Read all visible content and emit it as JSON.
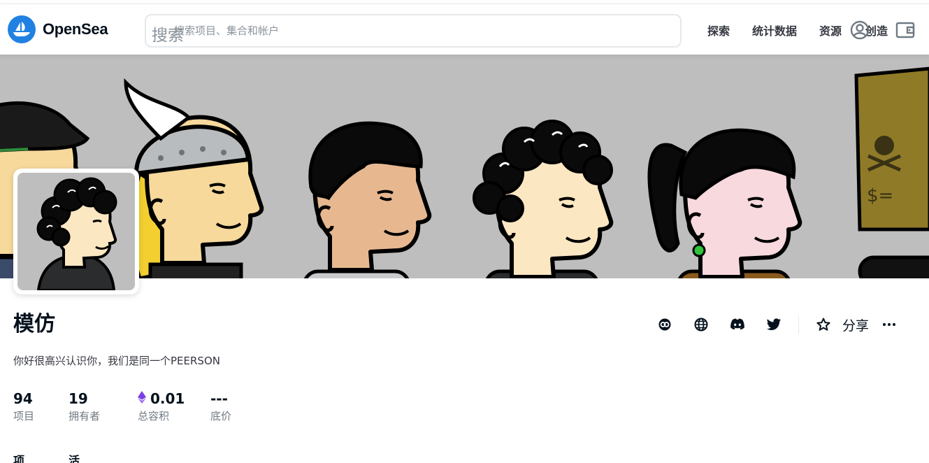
{
  "header": {
    "brand": "OpenSea",
    "search": {
      "label": "搜索",
      "placeholder": "搜索项目、集合和帐户",
      "value": ""
    },
    "nav": [
      {
        "label": "探索"
      },
      {
        "label": "统计数据"
      },
      {
        "label": "资源"
      },
      {
        "label": "创造"
      }
    ]
  },
  "collection": {
    "name": "模仿",
    "description": "你好很高兴认识你，我们是同一个PEERSON",
    "share_label": "分享",
    "stats": [
      {
        "value": "94",
        "label": "项目"
      },
      {
        "value": "19",
        "label": "拥有者"
      },
      {
        "value": "0.01",
        "label": "总容积",
        "currency_icon": "ethereum-icon"
      },
      {
        "value": "---",
        "label": "底价"
      }
    ],
    "tabs": [
      {
        "label": "项"
      },
      {
        "label": "活"
      }
    ]
  },
  "colors": {
    "brand_blue": "#2081e2",
    "banner_bg": "#bebebe",
    "text_primary": "#04111d",
    "text_secondary": "#707a83",
    "eth_purple": "#7b3fe4"
  }
}
